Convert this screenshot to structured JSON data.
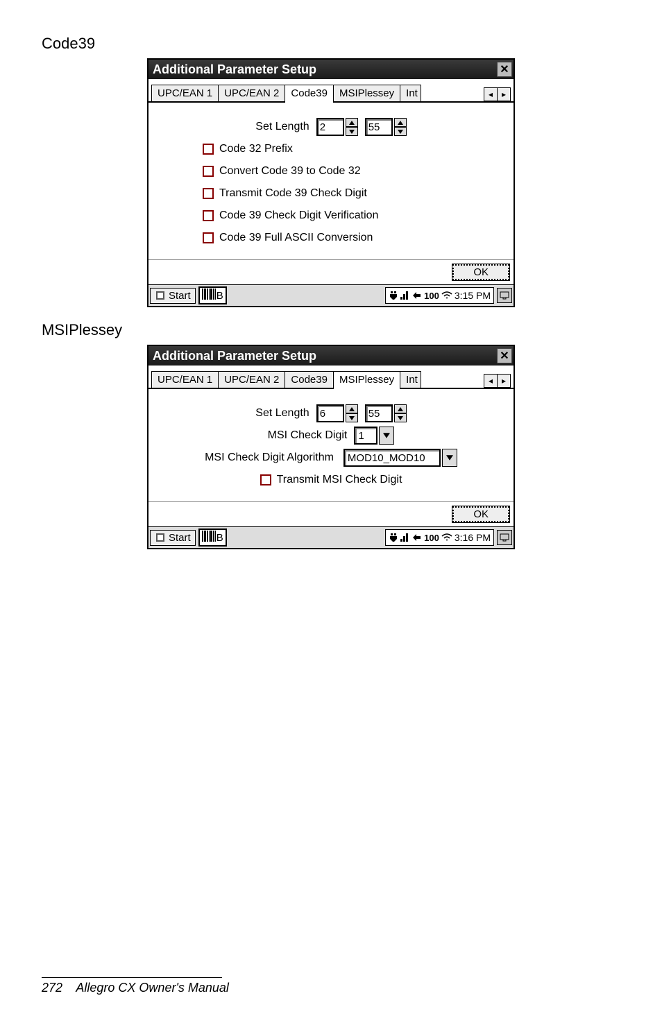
{
  "sections": {
    "code39_label": "Code39",
    "msiplessey_label": "MSIPlessey"
  },
  "window": {
    "title": "Additional Parameter Setup",
    "close_glyph": "✕",
    "ok_label": "OK"
  },
  "tabs": {
    "upcean1": "UPC/EAN 1",
    "upcean2": "UPC/EAN 2",
    "code39": "Code39",
    "msiplessey": "MSIPlessey",
    "int_partial": "Int",
    "scroll_left": "◂",
    "scroll_right": "▸"
  },
  "code39": {
    "set_length_label": "Set Length",
    "len_min": "2",
    "len_max": "55",
    "chk_code32_prefix": "Code 32 Prefix",
    "chk_convert": "Convert Code 39 to Code 32",
    "chk_transmit": "Transmit Code 39 Check Digit",
    "chk_verify": "Code 39 Check Digit Verification",
    "chk_fullascii": "Code 39 Full ASCII Conversion"
  },
  "msiplessey": {
    "set_length_label": "Set Length",
    "len_min": "6",
    "len_max": "55",
    "check_digit_label": "MSI Check Digit",
    "check_digit_value": "1",
    "algorithm_label": "MSI Check Digit Algorithm",
    "algorithm_value": "MOD10_MOD10",
    "chk_transmit": "Transmit MSI Check Digit"
  },
  "taskbar": {
    "start_label": "Start",
    "app_letter": "B",
    "battery_text": "100",
    "time1": "3:15 PM",
    "time2": "3:16 PM"
  },
  "footer": {
    "page_num": "272",
    "manual_title": "Allegro CX Owner's Manual"
  }
}
